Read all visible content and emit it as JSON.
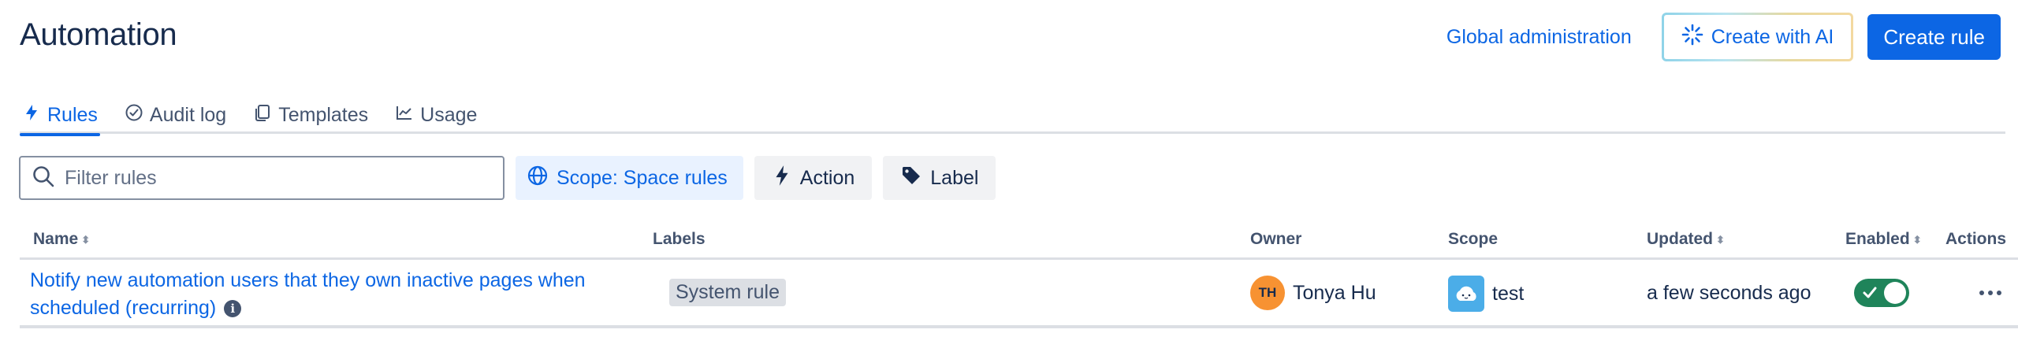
{
  "page": {
    "title": "Automation"
  },
  "header": {
    "global_admin": "Global administration",
    "create_ai": "Create with AI",
    "create_rule": "Create rule"
  },
  "tabs": [
    {
      "label": "Rules",
      "icon": "lightning-icon",
      "active": true
    },
    {
      "label": "Audit log",
      "icon": "check-circle-icon"
    },
    {
      "label": "Templates",
      "icon": "copy-icon"
    },
    {
      "label": "Usage",
      "icon": "chart-icon"
    }
  ],
  "filters": {
    "search_placeholder": "Filter rules",
    "scope": "Scope: Space rules",
    "action": "Action",
    "label": "Label"
  },
  "table": {
    "columns": {
      "name": "Name",
      "labels": "Labels",
      "owner": "Owner",
      "scope": "Scope",
      "updated": "Updated",
      "enabled": "Enabled",
      "actions": "Actions"
    },
    "rows": [
      {
        "name": "Notify new automation users that they own inactive pages when scheduled (recurring)",
        "label": "System rule",
        "owner_initials": "TH",
        "owner": "Tonya Hu",
        "scope": "test",
        "updated": "a few seconds ago",
        "enabled": true
      }
    ]
  },
  "colors": {
    "primary": "#0c66e4",
    "enabled_toggle": "#1f845a",
    "avatar": "#f79232",
    "space_icon": "#4bade8"
  }
}
